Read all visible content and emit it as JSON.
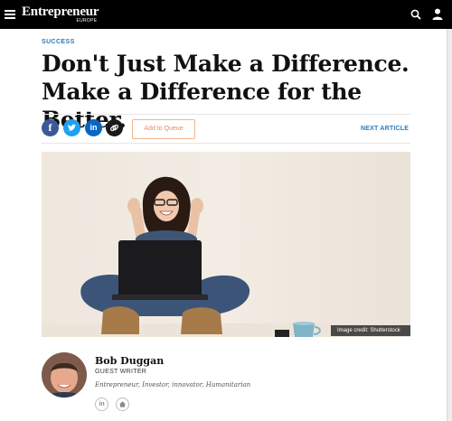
{
  "header": {
    "brand": "Entrepreneur",
    "brand_region": "EUROPE",
    "icons": [
      "menu-icon",
      "search-icon",
      "user-icon"
    ]
  },
  "article": {
    "section": "SUCCESS",
    "headline_line1": "Don't Just Make a Difference.",
    "headline_line2": "Make a Difference for the Better."
  },
  "share_bar": {
    "icons": [
      "facebook-icon",
      "twitter-icon",
      "linkedin-icon",
      "copy-link-icon"
    ],
    "queue_label": "Add to Queue",
    "next_label": "NEXT ARTICLE"
  },
  "hero": {
    "credit": "Image credit: Shutterstock"
  },
  "author": {
    "name": "Bob Duggan",
    "role": "GUEST WRITER",
    "bio": "Entrepreneur, Investor, innovator, Humanitarian",
    "icons": [
      "linkedin-icon",
      "home-icon"
    ]
  },
  "colors": {
    "accent": "#2b7bb9",
    "queue_border": "#f2b48d",
    "facebook": "#3b5998",
    "twitter": "#1da1f2",
    "linkedin": "#0a66c2"
  }
}
